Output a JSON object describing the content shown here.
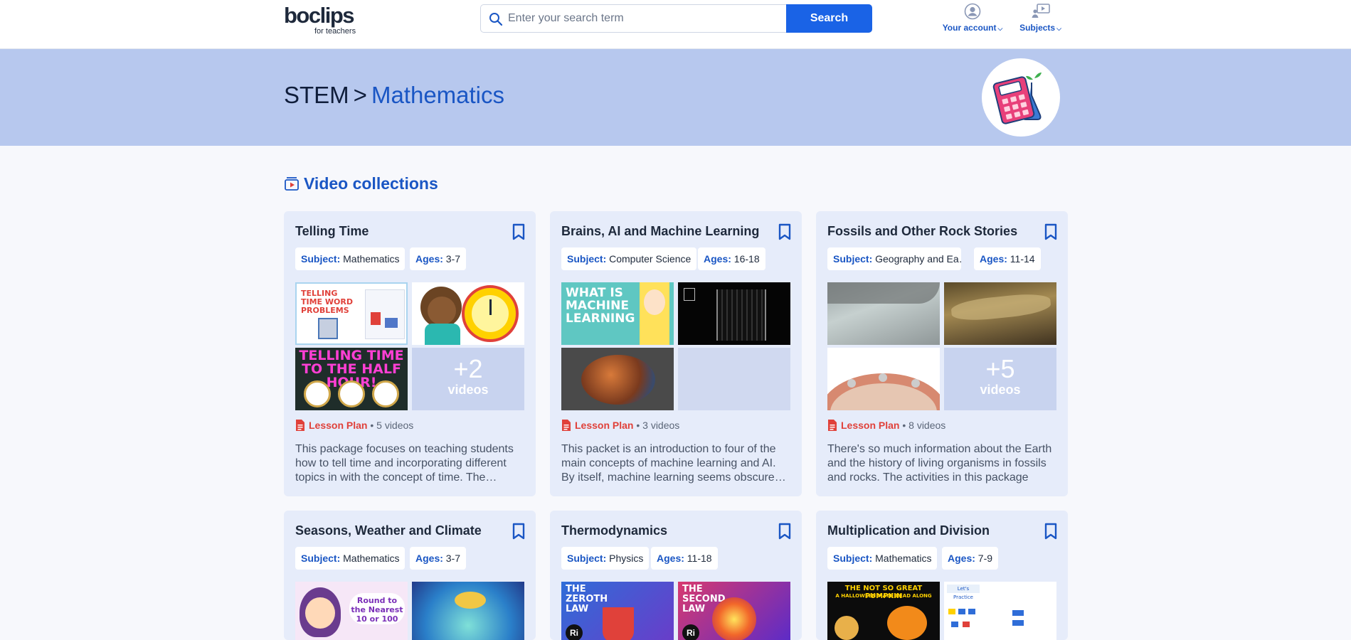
{
  "header": {
    "logo_text": "boclips",
    "logo_sub": "for teachers",
    "search_placeholder": "Enter your search term",
    "search_button": "Search",
    "nav": {
      "account_label": "Your account",
      "subjects_label": "Subjects"
    }
  },
  "banner": {
    "parent": "STEM",
    "separator": ">",
    "current": "Mathematics",
    "badge_icon": "calculator-flask-icon"
  },
  "section": {
    "title": "Video collections",
    "icon": "video-collection-icon"
  },
  "labels": {
    "subject": "Subject:",
    "ages": "Ages:",
    "lesson_plan": "Lesson Plan"
  },
  "cards": [
    {
      "title": "Telling Time",
      "subject": "Mathematics",
      "ages": "3-7",
      "videos_count": "• 5 videos",
      "more_count": "+2",
      "more_label": "videos",
      "thumb_texts": [
        "TELLING TIME WORD PROBLEMS",
        "",
        "TELLING TIME TO THE HALF HOUR!"
      ],
      "description": "This package focuses on teaching students how to tell time and incorporating different topics in with the concept of time. The…"
    },
    {
      "title": "Brains, AI and Machine Learning",
      "subject": "Computer Science",
      "ages": "16-18",
      "videos_count": "• 3 videos",
      "thumb_texts": [
        "WHAT IS MACHINE LEARNING",
        "",
        ""
      ],
      "description": "This packet is an introduction to four of the main concepts of machine learning and AI. By itself, machine learning seems obscure…"
    },
    {
      "title": "Fossils and Other Rock Stories",
      "subject": "Geography and Ea…",
      "ages": "11-14",
      "videos_count": "• 8 videos",
      "more_count": "+5",
      "more_label": "videos",
      "description": "There's so much information about the Earth and the history of living organisms in fossils and rocks. The activities in this package loo…"
    },
    {
      "title": "Seasons, Weather and Climate",
      "subject": "Mathematics",
      "ages": "3-7",
      "thumb_texts": [
        "Round to the Nearest 10 or 100",
        ""
      ]
    },
    {
      "title": "Thermodynamics",
      "subject": "Physics",
      "ages": "11-18",
      "thumb_texts": [
        "THE ZEROTH LAW",
        "THE SECOND LAW"
      ]
    },
    {
      "title": "Multiplication and Division",
      "subject": "Mathematics",
      "ages": "7-9",
      "thumb_texts": [
        "THE NOT SO GREAT PUMPKIN",
        "A HALLOWEEN MATH READ ALONG",
        "Let's Practice"
      ]
    }
  ],
  "colors": {
    "accent": "#1a63e6",
    "link": "#1a56c4",
    "banner": "#b7c8ee",
    "card": "#e6ecfa",
    "lesson_plan": "#e0413a"
  }
}
